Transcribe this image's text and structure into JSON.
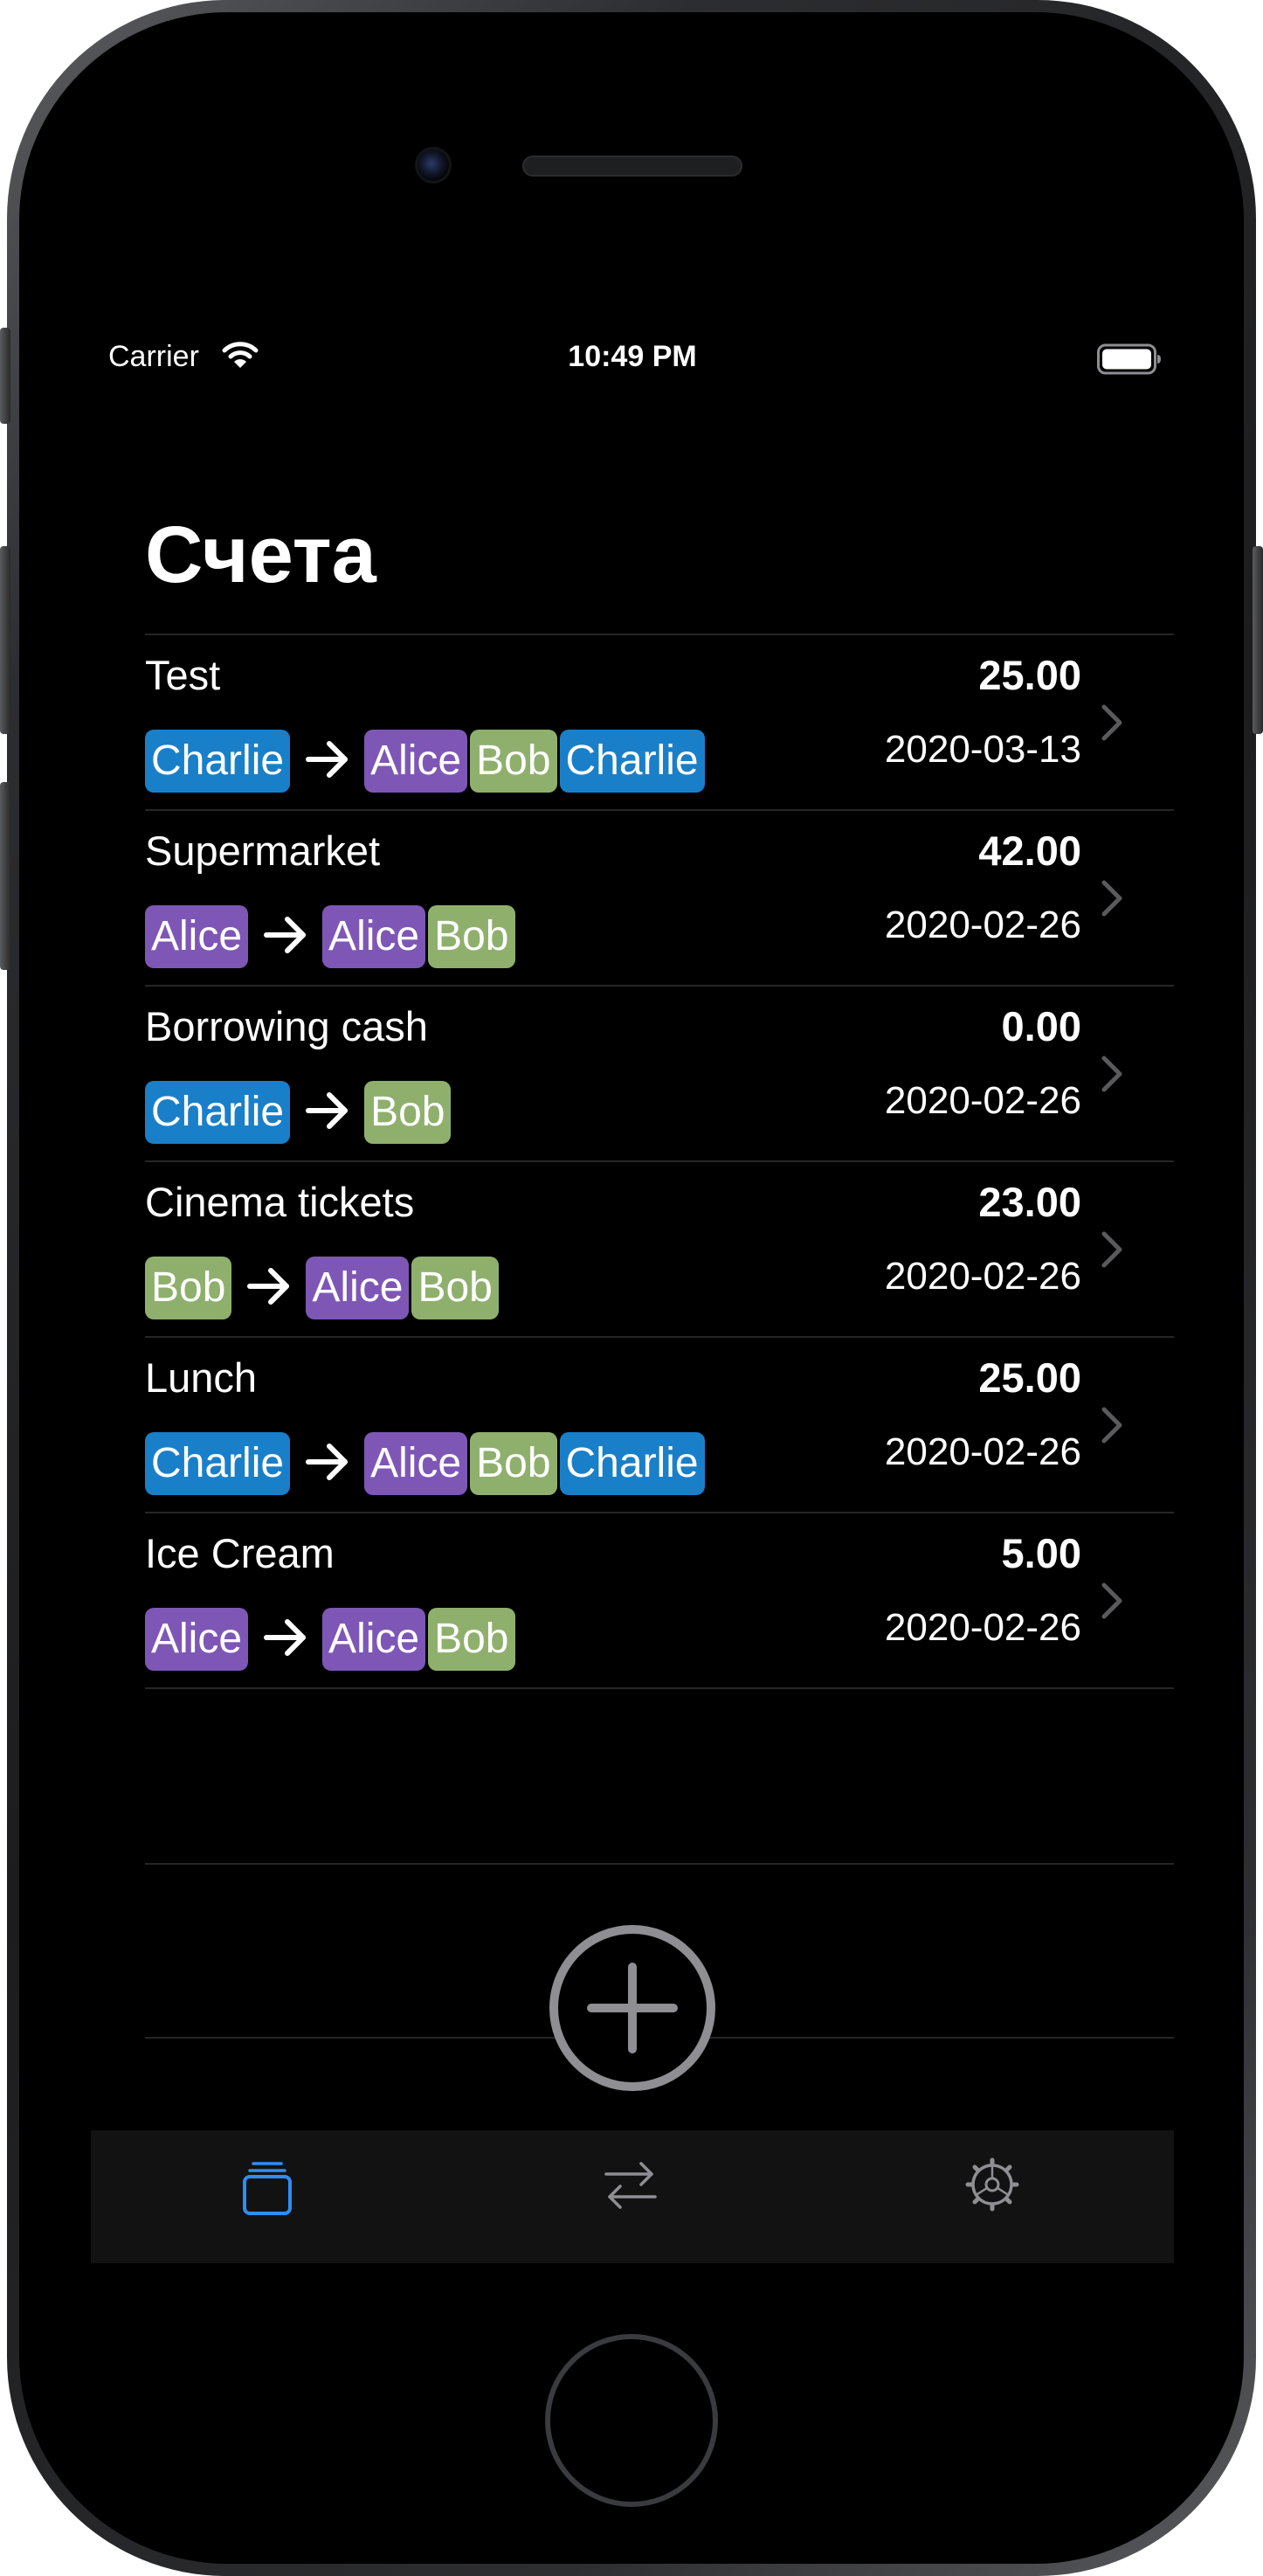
{
  "status_bar": {
    "carrier": "Carrier",
    "time": "10:49 PM"
  },
  "page_title": "Счета",
  "colors": {
    "Alice": "#7e57b6",
    "Bob": "#8fb06d",
    "Charlie": "#1a7fc9",
    "tab_active": "#2f8df6",
    "tab_inactive": "#8e8e93"
  },
  "bills": [
    {
      "name": "Test",
      "amount": "25.00",
      "date": "2020-03-13",
      "payer": "Charlie",
      "participants": [
        "Alice",
        "Bob",
        "Charlie"
      ]
    },
    {
      "name": "Supermarket",
      "amount": "42.00",
      "date": "2020-02-26",
      "payer": "Alice",
      "participants": [
        "Alice",
        "Bob"
      ]
    },
    {
      "name": "Borrowing cash",
      "amount": "0.00",
      "date": "2020-02-26",
      "payer": "Charlie",
      "participants": [
        "Bob"
      ]
    },
    {
      "name": "Cinema tickets",
      "amount": "23.00",
      "date": "2020-02-26",
      "payer": "Bob",
      "participants": [
        "Alice",
        "Bob"
      ]
    },
    {
      "name": "Lunch",
      "amount": "25.00",
      "date": "2020-02-26",
      "payer": "Charlie",
      "participants": [
        "Alice",
        "Bob",
        "Charlie"
      ]
    },
    {
      "name": "Ice Cream",
      "amount": "5.00",
      "date": "2020-02-26",
      "payer": "Alice",
      "participants": [
        "Alice",
        "Bob"
      ]
    }
  ],
  "icons": {
    "add": "plus-circle-icon",
    "chevron": "chevron-right-icon",
    "arrow": "arrow-right-icon"
  },
  "tabs": [
    {
      "name": "tab-bills",
      "icon": "stack-icon",
      "active": true
    },
    {
      "name": "tab-transfers",
      "icon": "arrows-exchange-icon",
      "active": false
    },
    {
      "name": "tab-settings",
      "icon": "gear-icon",
      "active": false
    }
  ]
}
